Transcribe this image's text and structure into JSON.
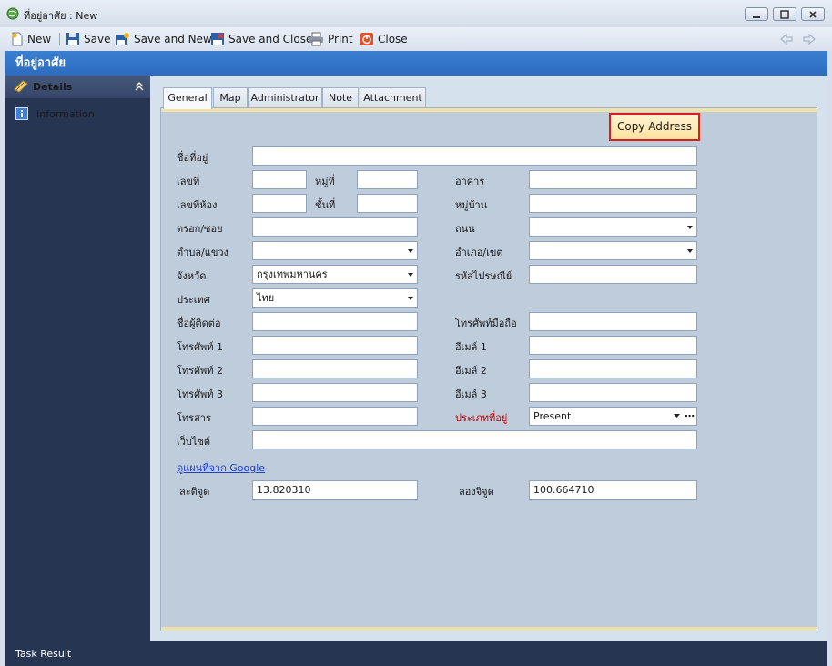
{
  "window": {
    "title": "ที่อยู่อาศัย : New"
  },
  "toolbar": {
    "new_label": "New",
    "save_label": "Save",
    "save_new_label": "Save and New",
    "save_close_label": "Save and Close",
    "print_label": "Print",
    "close_label": "Close"
  },
  "header": {
    "title": "ที่อยู่อาศัย"
  },
  "sidebar": {
    "section_label": "Details",
    "items": [
      {
        "label": "Information"
      }
    ]
  },
  "tabs": [
    {
      "label": "General"
    },
    {
      "label": "Map"
    },
    {
      "label": "Administrator"
    },
    {
      "label": "Note"
    },
    {
      "label": "Attachment"
    }
  ],
  "form": {
    "copy_button": "Copy Address",
    "labels": {
      "address_name": "ชื่อที่อยู่",
      "house_no": "เลขที่",
      "moo": "หมู่ที่",
      "building": "อาคาร",
      "room_no": "เลขที่ห้อง",
      "floor": "ชั้นที่",
      "village": "หมู่บ้าน",
      "soi": "ตรอก/ซอย",
      "road": "ถนน",
      "subdistrict": "ตำบล/แขวง",
      "district": "อำเภอ/เขต",
      "province": "จังหวัด",
      "postcode": "รหัสไปรษณีย์",
      "country": "ประเทศ",
      "contact_name": "ชื่อผู้ติดต่อ",
      "mobile": "โทรศัพท์มือถือ",
      "phone1": "โทรศัพท์ 1",
      "email1": "อีเมล์ 1",
      "phone2": "โทรศัพท์ 2",
      "email2": "อีเมล์ 2",
      "phone3": "โทรศัพท์ 3",
      "email3": "อีเมล์ 3",
      "fax": "โทรสาร",
      "address_type": "ประเภทที่อยู่",
      "website": "เว็บไซต์",
      "latitude": "ละติจูด",
      "longitude": "ลองจิจูด"
    },
    "values": {
      "province": "กรุงเทพมหานคร",
      "country": "ไทย",
      "address_type": "Present",
      "latitude": "13.820310",
      "longitude": "100.664710"
    },
    "map_link": "ดูแผนที่จาก Google"
  },
  "status": {
    "label": "Task Result"
  },
  "colors": {
    "header_blue": "#2f72c6",
    "sidebar_navy": "#263552",
    "highlight_red": "#d81e1e"
  }
}
